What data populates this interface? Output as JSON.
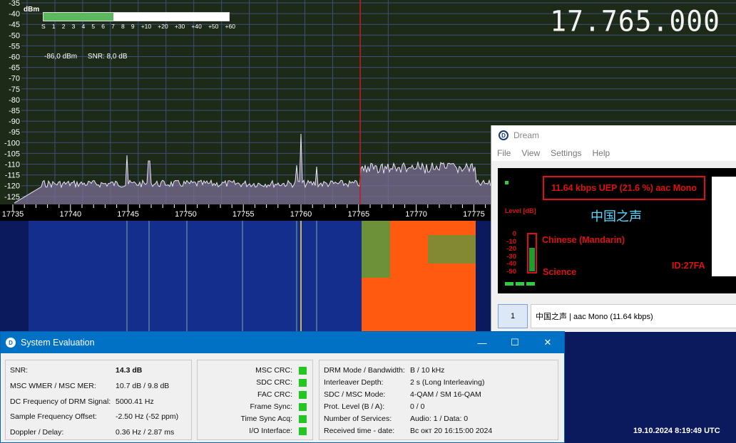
{
  "sdr": {
    "frequency_display": "17.765.000",
    "smeter": {
      "unit_label": "dBm",
      "fill_fraction": 0.375,
      "scale": [
        "S",
        "1",
        "2",
        "3",
        "4",
        "5",
        "6",
        "7",
        "8",
        "9",
        "+10",
        "+20",
        "+30",
        "+40",
        "+50",
        "+60"
      ]
    },
    "signal_level": "-86,0 dBm",
    "snr": "SNR: 8,0 dB",
    "db_axis": [
      "-35",
      "-40",
      "-45",
      "-50",
      "-55",
      "-60",
      "-65",
      "-70",
      "-75",
      "-80",
      "-85",
      "-90",
      "-95",
      "-100",
      "-105",
      "-110",
      "-115",
      "-120",
      "-125"
    ],
    "freq_axis": [
      "17735",
      "17740",
      "17745",
      "17750",
      "17755",
      "17760",
      "17765",
      "17770",
      "17775"
    ],
    "datetime": "19.10.2024 8:19:49 UTC"
  },
  "dream": {
    "title": "Dream",
    "icon": "dream-logo-icon",
    "menu": [
      "File",
      "View",
      "Settings",
      "Help"
    ],
    "service_info": "11.64 kbps UEP (21.6 %)  aac  Mono",
    "station": "中国之声",
    "level_label": "Level [dB]",
    "level_scale": [
      "0",
      "-10",
      "-20",
      "-30",
      "-40",
      "-50"
    ],
    "level_fraction": 0.62,
    "language": "Chinese (Mandarin)",
    "program_type": "Science",
    "service_id": "ID:27FA",
    "service_button": "1",
    "service_row_label": "中国之声   |   aac Mono (11.64 kbps)"
  },
  "system_evaluation": {
    "title": "System Evaluation",
    "icon": "dream-logo-icon",
    "window_controls": [
      "—",
      "☐",
      "✕"
    ],
    "measurements": [
      {
        "label": "SNR:",
        "value": "14.3 dB"
      },
      {
        "label": "MSC WMER / MSC MER:",
        "value": "10.7 dB / 9.8 dB"
      },
      {
        "label": "DC Frequency of DRM Signal:",
        "value": "5000.41 Hz"
      },
      {
        "label": "Sample Frequency Offset:",
        "value": "-2.50 Hz (-52 ppm)"
      },
      {
        "label": "Doppler / Delay:",
        "value": "0.36 Hz / 2.87 ms"
      }
    ],
    "status": [
      "MSC CRC:",
      "SDC CRC:",
      "FAC CRC:",
      "Frame Sync:",
      "Time Sync Acq:",
      "I/O Interface:"
    ],
    "status_color": "#22c722",
    "drm_info": [
      {
        "label": "DRM Mode / Bandwidth:",
        "value": "B / 10 kHz"
      },
      {
        "label": "Interleaver Depth:",
        "value": "2 s (Long Interleaving)"
      },
      {
        "label": "SDC / MSC Mode:",
        "value": "4-QAM / SM 16-QAM"
      },
      {
        "label": "Prot. Level (B / A):",
        "value": "0 / 0"
      },
      {
        "label": "Number of Services:",
        "value": "Audio: 1 / Data: 0"
      },
      {
        "label": "Received time - date:",
        "value": "Вс окт 20 16:15:00 2024"
      }
    ]
  },
  "colors": {
    "spectrum_bg": "#1c2a17",
    "grid": "#3c4f78",
    "tuning_line": "#c01818",
    "waterfall_bg": "#0a1a5c",
    "drm_signal": "#ff5a10",
    "dream_text_red": "#e01010",
    "station_cyan": "#5ad8ff",
    "title_blue": "#0071c5"
  }
}
